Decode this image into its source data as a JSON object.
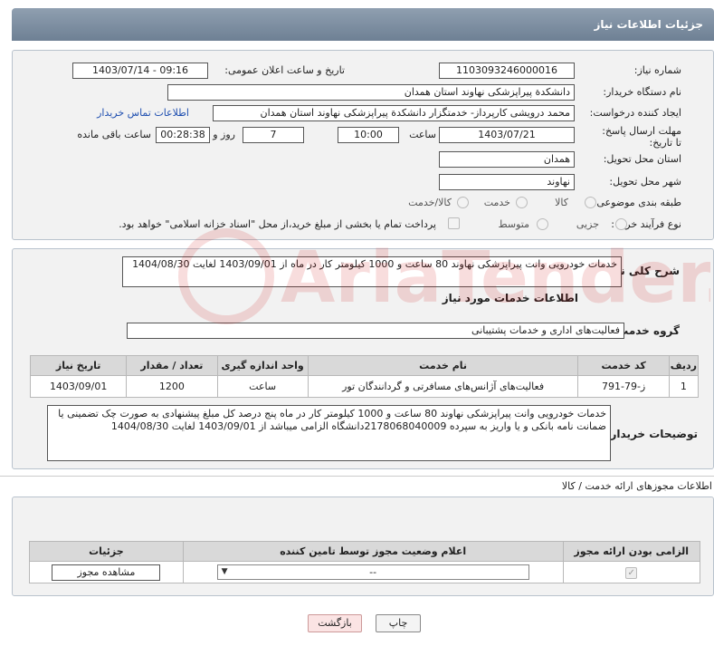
{
  "header": {
    "title": "جزئیات اطلاعات نیاز"
  },
  "form": {
    "need_number_label": "شماره نیاز:",
    "need_number": "1103093246000016",
    "announce_label": "تاریخ و ساعت اعلان عمومی:",
    "announce_value": "1403/07/14 - 09:16",
    "buyer_org_label": "نام دستگاه خریدار:",
    "buyer_org": "دانشکدة پیراپزشکی نهاوند  استان همدان",
    "requester_label": "ایجاد کننده درخواست:",
    "requester": "محمد درویشی کارپرداز- خدمتگزار دانشکدة پیراپزشکی نهاوند  استان همدان",
    "contact_link": "اطلاعات تماس خریدار",
    "deadline_label": "مهلت ارسال پاسخ: تا تاریخ:",
    "deadline_date": "1403/07/21",
    "time_label": "ساعت",
    "deadline_time": "10:00",
    "days_value": "7",
    "days_label": "روز و",
    "remaining_time": "00:28:38",
    "remaining_label": "ساعت باقی مانده",
    "province_label": "استان محل تحویل:",
    "province": "همدان",
    "city_label": "شهر محل تحویل:",
    "city": "نهاوند",
    "category_label": "طبقه بندی موضوعی:",
    "category_options": [
      "کالا",
      "خدمت",
      "کالا/خدمت"
    ],
    "process_label": "نوع فرآیند خرید :",
    "process_options": [
      "جزیی",
      "متوسط"
    ],
    "payment_note": "پرداخت تمام یا بخشی از مبلغ خرید،از محل \"اسناد خزانه اسلامی\" خواهد بود."
  },
  "summary": {
    "label": "شرح کلی نیاز:",
    "text": "خدمات خودرویی وانت پیراپزشکی نهاوند 80 ساعت و  1000 کیلومتر کار در ماه  از 1403/09/01 لغایت 1404/08/30",
    "services_title": "اطلاعات خدمات مورد نیاز",
    "group_label": "گروه خدمت:",
    "group_value": "فعالیت‌های اداری و خدمات پشتیبانی"
  },
  "services_table": {
    "headers": [
      "ردیف",
      "کد خدمت",
      "نام خدمت",
      "واحد اندازه گیری",
      "تعداد / مقدار",
      "تاریخ نیاز"
    ],
    "rows": [
      [
        "1",
        "ز-79-791",
        "فعالیت‌های آژانس‌های مسافرتی و گردانندگان تور",
        "ساعت",
        "1200",
        "1403/09/01"
      ]
    ]
  },
  "buyer_notes": {
    "label": "توضیحات خریدار:",
    "text": "خدمات خودرویی وانت پیراپزشکی نهاوند 80 ساعت و  1000 کیلومتر کار در ماه پنج درصد کل مبلغ پیشنهادی به صورت چک تضمینی یا ضمانت نامه بانکی و یا واریز به سپرده 2178068040009دانشگاه الزامی میباشد از 1403/09/01 لغایت 1404/08/30"
  },
  "permits": {
    "section_title": "اطلاعات مجوزهای ارائه خدمت / کالا",
    "headers": [
      "الزامی بودن ارائه مجوز",
      "اعلام وضعیت مجوز توسط تامین کننده",
      "جزئیات"
    ],
    "select_value": "--",
    "view_button": "مشاهده مجوز"
  },
  "footer": {
    "print_button": "چاپ",
    "back_button": "بازگشت"
  },
  "watermark": {
    "text": "AriaTender.neT"
  }
}
